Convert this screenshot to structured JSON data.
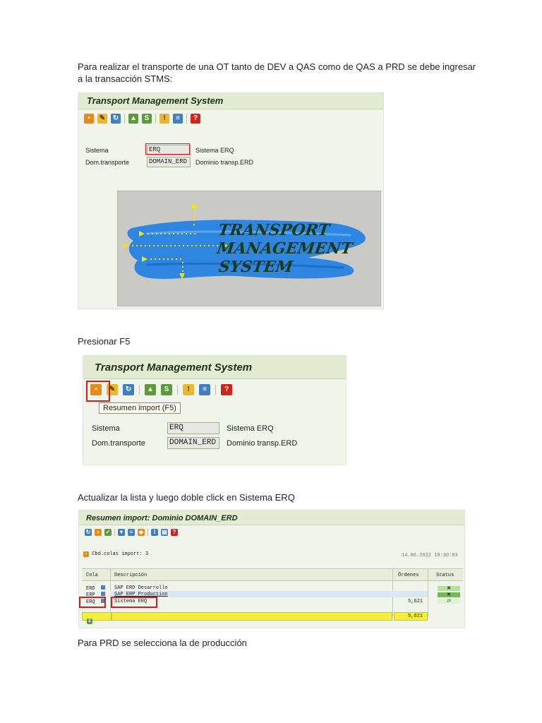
{
  "paragraphs": {
    "p1_line1": "Para realizar el transporte de una OT tanto de DEV a QAS como de QAS a PRD se debe ingresar",
    "p1_line2": "a la transacción STMS:",
    "p2": "Presionar F5",
    "p3": "Actualizar la lista y luego doble click en Sistema ERQ",
    "p4": "Para PRD se selecciona la de producción"
  },
  "stms_screen": {
    "title": "Transport Management System",
    "sistema_label": "Sistema",
    "sistema_value": "ERQ",
    "sistema_desc": "Sistema ERQ",
    "dom_label": "Dom.transporte",
    "dom_value": "DOMAIN_ERD",
    "dom_desc": "Dominio transp.ERD"
  },
  "logo": {
    "line1": "TRANSPORT",
    "line2": "MANAGEMENT",
    "line3": "SYSTEM"
  },
  "stms_screen2": {
    "title": "Transport Management System",
    "tooltip": "Resumen import  (F5)",
    "sistema_label": "Sistema",
    "sistema_value": "ERQ",
    "sistema_desc": "Sistema ERQ",
    "dom_label": "Dom.transporte",
    "dom_value": "DOMAIN_ERD",
    "dom_desc": "Dominio transp.ERD"
  },
  "import_screen": {
    "title": "Resumen import: Dominio DOMAIN_ERD",
    "count_label": "Cbd.colas import: 3",
    "timestamp": "14.06.2022 18:30:03",
    "columns": {
      "cola": "Cola",
      "descripcion": "Descripción",
      "ordenes": "Órdenes",
      "status": "Status"
    },
    "rows": [
      {
        "cola": "ERD",
        "descripcion": "SAP ERD Desarrollo",
        "ordenes": ""
      },
      {
        "cola": "ERP",
        "descripcion": "SAP ERP Production",
        "ordenes": ""
      },
      {
        "cola": "ERQ",
        "descripcion": "Sistema ERQ",
        "ordenes": "5,621"
      }
    ],
    "total": "5,621"
  },
  "colors": {
    "sap_title_bg": "#e3ecd2",
    "highlight_red": "#d21d1d",
    "total_yellow": "#f3ef3a",
    "logo_blue": "#2f86e0"
  }
}
